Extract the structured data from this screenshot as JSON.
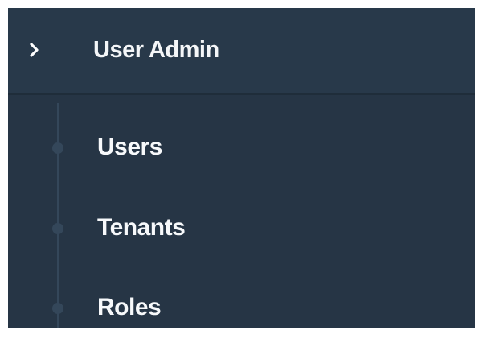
{
  "menu": {
    "group": {
      "icon": "chevron-right-icon",
      "title": "User Admin"
    },
    "items": [
      {
        "label": "Users"
      },
      {
        "label": "Tenants"
      },
      {
        "label": "Roles"
      }
    ]
  },
  "colors": {
    "background": "#263545",
    "header_background": "#28394a",
    "text": "#f4f6f8",
    "timeline": "#34475a"
  }
}
